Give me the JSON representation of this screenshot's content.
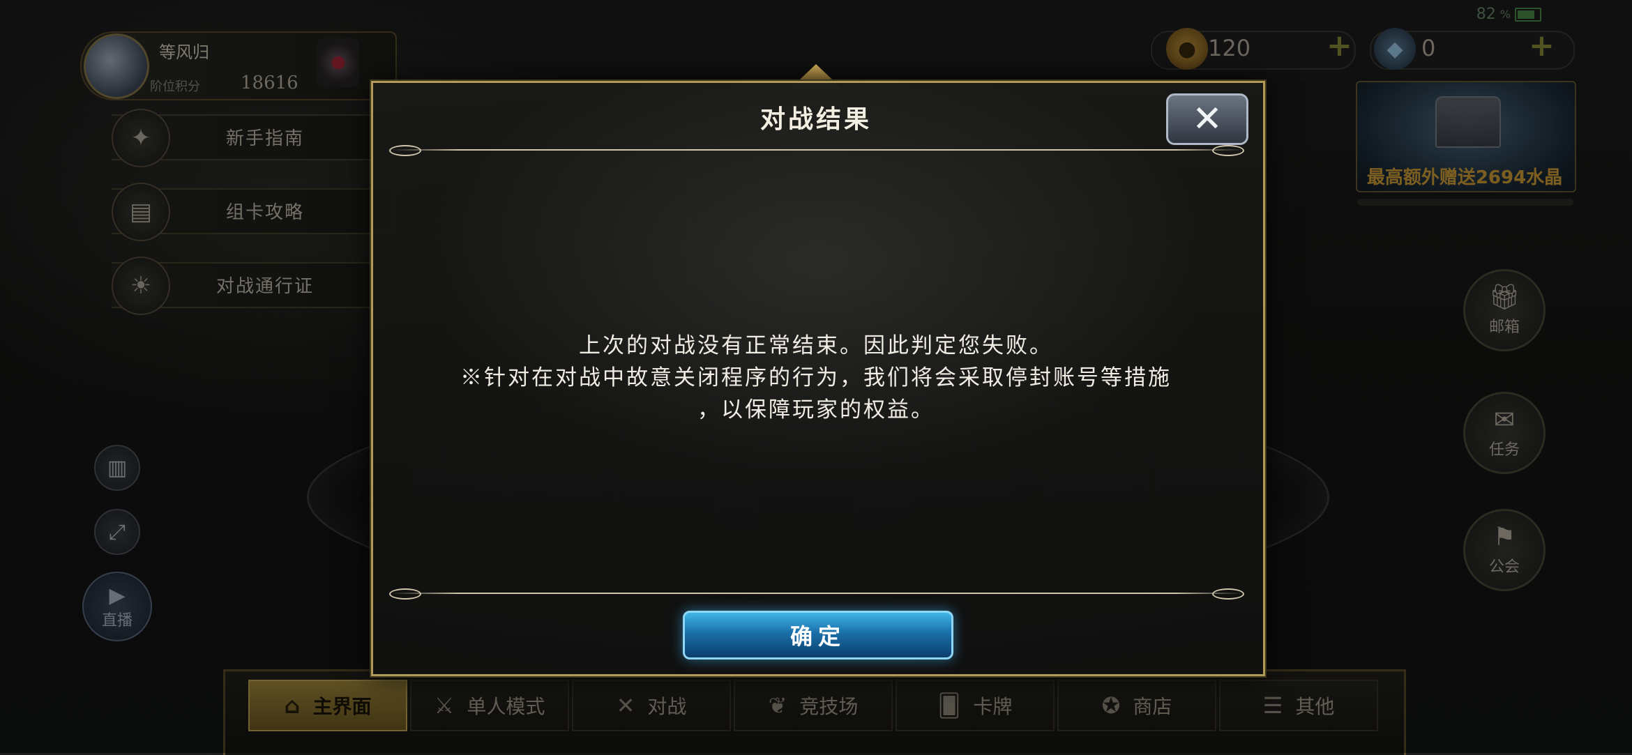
{
  "status_bar": {
    "battery_percent": "82",
    "battery_unit": "%"
  },
  "profile": {
    "name": "等风归",
    "score_label": "阶位积分",
    "score": "18616"
  },
  "left_menu": {
    "items": [
      {
        "label": "新手指南",
        "icon": "compass-icon"
      },
      {
        "label": "组卡攻略",
        "icon": "cards-icon"
      },
      {
        "label": "对战通行证",
        "icon": "sun-emblem-icon"
      }
    ]
  },
  "currency": {
    "gold": {
      "value": "120",
      "icon": "coin-icon"
    },
    "crystal": {
      "value": "0",
      "icon": "crystal-icon"
    }
  },
  "promo": {
    "text": "最高额外赠送2694水晶"
  },
  "right_buttons": [
    {
      "label": "邮箱",
      "icon": "gift-box-icon"
    },
    {
      "label": "任务",
      "icon": "scroll-icon"
    },
    {
      "label": "公会",
      "icon": "banner-icon"
    }
  ],
  "left_tools": {
    "live_label": "直播"
  },
  "bottom_nav": {
    "items": [
      {
        "label": "主界面",
        "active": true
      },
      {
        "label": "单人模式",
        "active": false
      },
      {
        "label": "对战",
        "active": false
      },
      {
        "label": "竞技场",
        "active": false
      },
      {
        "label": "卡牌",
        "active": false
      },
      {
        "label": "商店",
        "active": false
      },
      {
        "label": "其他",
        "active": false
      }
    ]
  },
  "dialog": {
    "title": "对战结果",
    "close_symbol": "✕",
    "message_line1": "上次的对战没有正常结束。因此判定您失败。",
    "message_line2": "※针对在对战中故意关闭程序的行为，我们将会采取停封账号等措施",
    "message_line3": "，以保障玩家的权益。",
    "confirm_label": "确定"
  },
  "colors": {
    "accent_gold": "#b09a5a",
    "confirm_blue": "#1a6fa8",
    "promo_text": "#d8a23a"
  }
}
